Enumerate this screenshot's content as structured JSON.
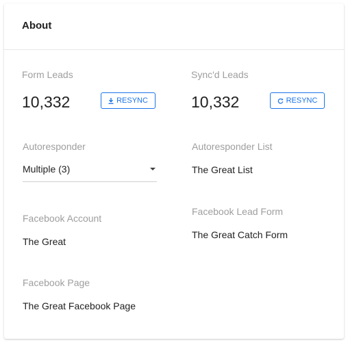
{
  "card": {
    "title": "About"
  },
  "form_leads": {
    "label": "Form Leads",
    "value": "10,332",
    "button_label": "RESYNC",
    "button_icon": "download-icon"
  },
  "syncd_leads": {
    "label": "Sync'd Leads",
    "value": "10,332",
    "button_label": "RESYNC",
    "button_icon": "refresh-icon"
  },
  "autoresponder": {
    "label": "Autoresponder",
    "selected": "Multiple (3)"
  },
  "autoresponder_list": {
    "label": "Autoresponder List",
    "value": "The Great List"
  },
  "facebook_account": {
    "label": "Facebook Account",
    "value": "The Great"
  },
  "facebook_lead_form": {
    "label": "Facebook Lead Form",
    "value": "The Great Catch Form"
  },
  "facebook_page": {
    "label": "Facebook Page",
    "value": "The Great Facebook Page"
  },
  "colors": {
    "accent": "#1a73e8",
    "label": "#9e9e9e",
    "text": "#212121"
  }
}
